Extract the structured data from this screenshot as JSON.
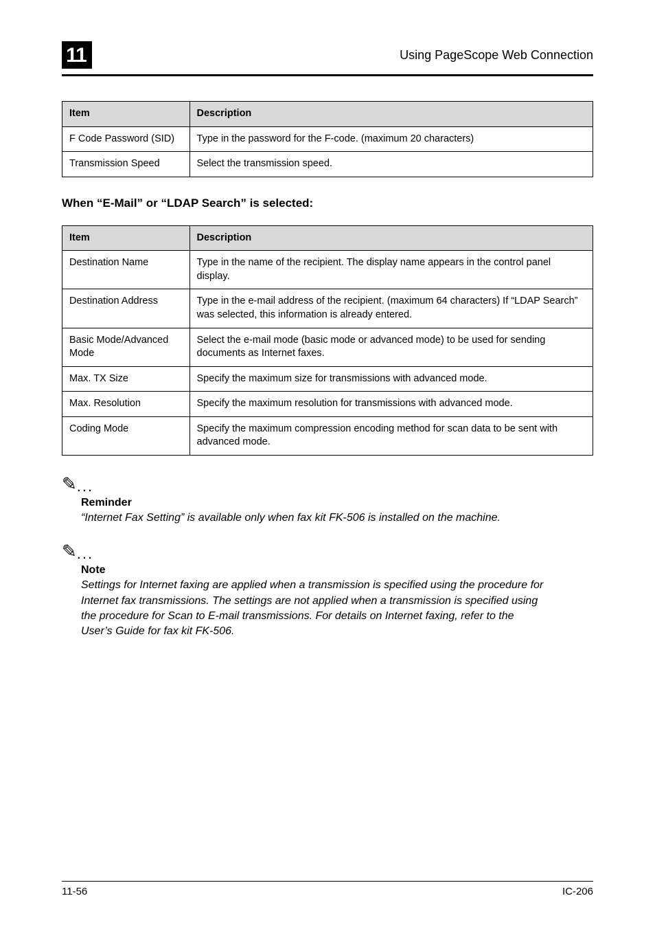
{
  "header": {
    "chapter_number": "11",
    "page_title": "Using PageScope Web Connection"
  },
  "table1": {
    "headers": {
      "item": "Item",
      "description": "Description"
    },
    "rows": [
      {
        "item": "F Code Password (SID)",
        "description": "Type in the password for the F-code. (maximum 20 characters)"
      },
      {
        "item": "Transmission Speed",
        "description": "Select the transmission speed."
      }
    ]
  },
  "section_heading": "When “E-Mail” or “LDAP Search” is selected:",
  "table2": {
    "headers": {
      "item": "Item",
      "description": "Description"
    },
    "rows": [
      {
        "item": "Destination Name",
        "description": "Type in the name of the recipient. The display name appears in the control panel display."
      },
      {
        "item": "Destination Address",
        "description": "Type in the e-mail address of the recipient. (maximum 64 characters) If “LDAP Search” was selected, this information is already entered."
      },
      {
        "item": "Basic Mode/Advanced Mode",
        "description": "Select the e-mail mode (basic mode or advanced mode) to be used for sending documents as Internet faxes."
      },
      {
        "item": "Max. TX Size",
        "description": "Specify the maximum size for transmissions with advanced mode."
      },
      {
        "item": "Max. Resolution",
        "description": "Specify the maximum resolution for transmissions with advanced mode."
      },
      {
        "item": "Coding Mode",
        "description": "Specify the maximum compression encoding method for scan data to be sent with advanced mode."
      }
    ]
  },
  "notes": {
    "reminder_label": "Reminder",
    "reminder_body": "“Internet Fax Setting” is available only when fax kit FK-506 is installed on the machine.",
    "note_label": "Note",
    "note_body": "Settings for Internet faxing are applied when a transmission is specified using the procedure for Internet fax transmissions. The settings are not applied when a transmission is specified using the procedure for Scan to E-mail transmissions. For details on Internet faxing, refer to the User’s Guide for fax kit FK-506."
  },
  "footer": {
    "page_number": "11-56",
    "model": "IC-206"
  },
  "icons": {
    "note_glyph": "✎",
    "dots": "..."
  }
}
